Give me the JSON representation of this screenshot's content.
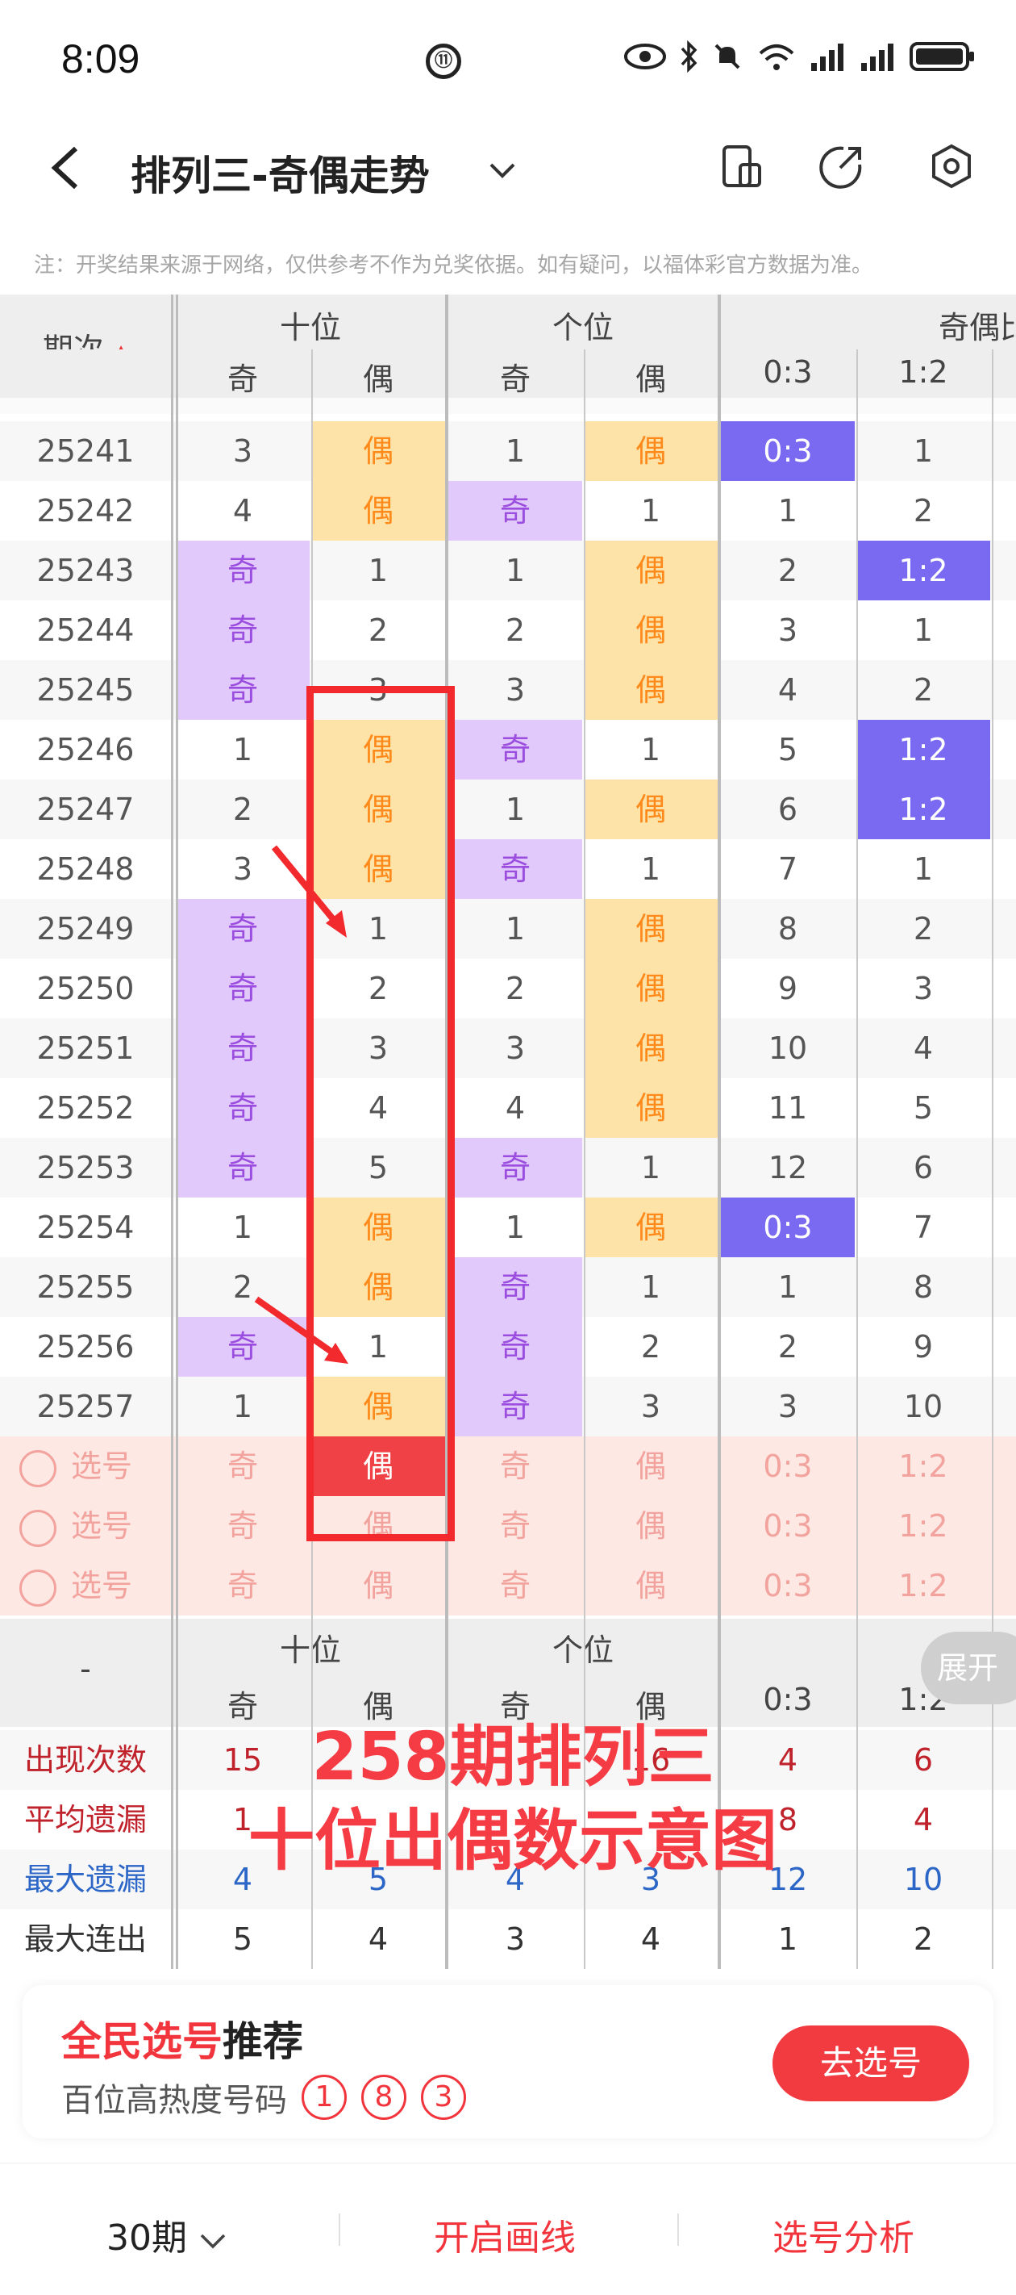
{
  "status": {
    "time": "8:09"
  },
  "header": {
    "title": "排列三-奇偶走势"
  },
  "note": "注：开奖结果来源于网络，仅供参考不作为兑奖依据。如有疑问，以福体彩官方数据为准。",
  "table": {
    "period_header": "期次",
    "groups": [
      "十位",
      "个位",
      "奇偶比"
    ],
    "sub": {
      "odd": "奇",
      "even": "偶",
      "r03": "0:3",
      "r12": "1:2"
    },
    "rows": [
      {
        "p": "25241",
        "a": "3",
        "b": "偶",
        "c": "1",
        "d": "偶",
        "e": "0:3",
        "f": "1"
      },
      {
        "p": "25242",
        "a": "4",
        "b": "偶",
        "c": "奇",
        "d": "1",
        "e": "1",
        "f": "2"
      },
      {
        "p": "25243",
        "a": "奇",
        "b": "1",
        "c": "1",
        "d": "偶",
        "e": "2",
        "f": "1:2"
      },
      {
        "p": "25244",
        "a": "奇",
        "b": "2",
        "c": "2",
        "d": "偶",
        "e": "3",
        "f": "1"
      },
      {
        "p": "25245",
        "a": "奇",
        "b": "3",
        "c": "3",
        "d": "偶",
        "e": "4",
        "f": "2"
      },
      {
        "p": "25246",
        "a": "1",
        "b": "偶",
        "c": "奇",
        "d": "1",
        "e": "5",
        "f": "1:2"
      },
      {
        "p": "25247",
        "a": "2",
        "b": "偶",
        "c": "1",
        "d": "偶",
        "e": "6",
        "f": "1:2"
      },
      {
        "p": "25248",
        "a": "3",
        "b": "偶",
        "c": "奇",
        "d": "1",
        "e": "7",
        "f": "1"
      },
      {
        "p": "25249",
        "a": "奇",
        "b": "1",
        "c": "1",
        "d": "偶",
        "e": "8",
        "f": "2"
      },
      {
        "p": "25250",
        "a": "奇",
        "b": "2",
        "c": "2",
        "d": "偶",
        "e": "9",
        "f": "3"
      },
      {
        "p": "25251",
        "a": "奇",
        "b": "3",
        "c": "3",
        "d": "偶",
        "e": "10",
        "f": "4"
      },
      {
        "p": "25252",
        "a": "奇",
        "b": "4",
        "c": "4",
        "d": "偶",
        "e": "11",
        "f": "5"
      },
      {
        "p": "25253",
        "a": "奇",
        "b": "5",
        "c": "奇",
        "d": "1",
        "e": "12",
        "f": "6"
      },
      {
        "p": "25254",
        "a": "1",
        "b": "偶",
        "c": "1",
        "d": "偶",
        "e": "0:3",
        "f": "7"
      },
      {
        "p": "25255",
        "a": "2",
        "b": "偶",
        "c": "奇",
        "d": "1",
        "e": "1",
        "f": "8"
      },
      {
        "p": "25256",
        "a": "奇",
        "b": "1",
        "c": "奇",
        "d": "2",
        "e": "2",
        "f": "9"
      },
      {
        "p": "25257",
        "a": "1",
        "b": "偶",
        "c": "奇",
        "d": "3",
        "e": "3",
        "f": "10"
      }
    ],
    "select_label": "选号",
    "stats": [
      {
        "label": "出现次数",
        "a": "15",
        "b": "",
        "c": "",
        "d": "16",
        "e": "4",
        "f": "6"
      },
      {
        "label": "平均遗漏",
        "a": "1",
        "b": "",
        "c": "",
        "d": "",
        "e": "8",
        "f": "4"
      },
      {
        "label": "最大遗漏",
        "a": "4",
        "b": "5",
        "c": "4",
        "d": "3",
        "e": "12",
        "f": "10"
      },
      {
        "label": "最大连出",
        "a": "5",
        "b": "4",
        "c": "3",
        "d": "4",
        "e": "1",
        "f": "2"
      }
    ],
    "stats_dash": "-"
  },
  "expand_label": "展开",
  "overlay": {
    "line1": "258期排列三",
    "line2": "十位出偶数示意图"
  },
  "recommend": {
    "title_red": "全民选号",
    "title_black": "推荐",
    "sub": "百位高热度号码",
    "balls": [
      "1",
      "8",
      "3"
    ],
    "button": "去选号"
  },
  "bottom": {
    "periods": "30期",
    "draw": "开启画线",
    "analysis": "选号分析"
  },
  "colors": {
    "odd": "#9a4dde",
    "even": "#ff8a1c",
    "accent": "#f2353d",
    "ratio": "#7a6af2"
  }
}
